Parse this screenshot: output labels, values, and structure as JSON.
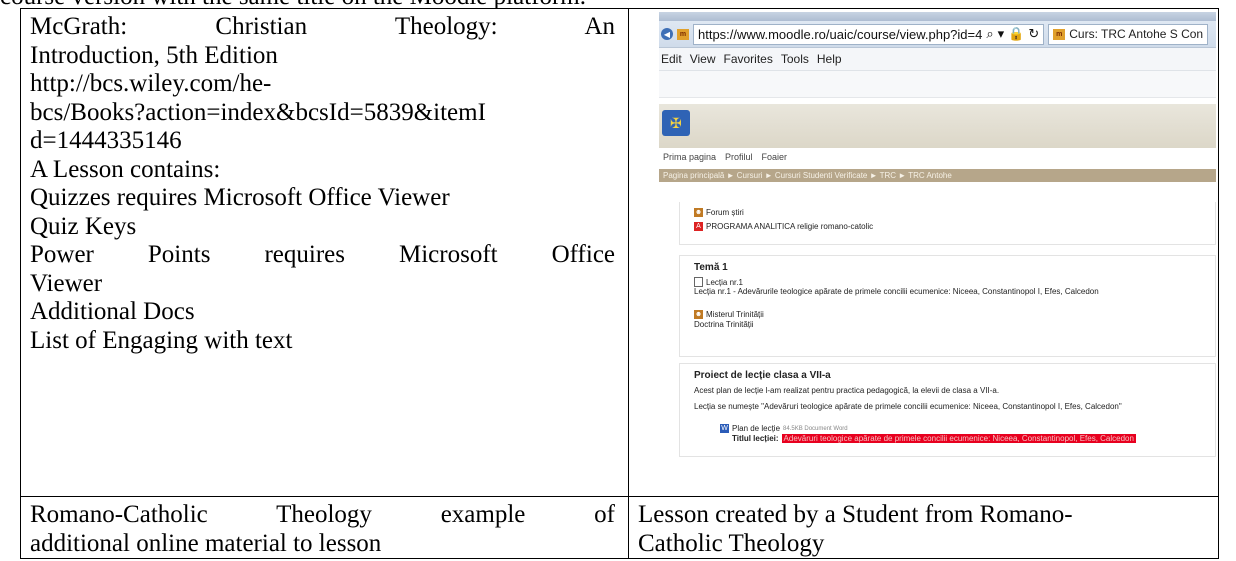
{
  "document": {
    "top_line": "course version with the same title on the Moodle platform.",
    "left_cell": {
      "citation_line1": [
        "McGrath:",
        "Christian",
        "Theology:",
        "An"
      ],
      "citation_line2": "Introduction, 5th Edition",
      "url_lines": [
        "http://bcs.wiley.com/he-",
        "bcs/Books?action=index&bcsId=5839&itemI",
        "d=1444335146"
      ],
      "heading": "A Lesson contains:",
      "items": [
        "Quizzes requires Microsoft Office Viewer",
        "Quiz Keys"
      ],
      "power_points_line1": [
        "Power",
        "Points",
        "requires",
        "Microsoft",
        "Office"
      ],
      "power_points_line2": "Viewer",
      "items_after": [
        "Additional Docs",
        "List of Engaging with text"
      ]
    },
    "captions": {
      "left_line1": [
        "Romano-Catholic",
        "Theology",
        "example",
        "of"
      ],
      "left_line2": "additional online material to lesson",
      "right_line1": "Lesson created by a Student from Romano-",
      "right_line2": "Catholic Theology"
    }
  },
  "screenshot": {
    "browser": {
      "url": "https://www.moodle.ro/uaic/course/view.php?id=4",
      "tab_title": "Curs: TRC Antohe S Con",
      "menu": [
        "Edit",
        "View",
        "Favorites",
        "Tools",
        "Help"
      ]
    },
    "moodle": {
      "nav_links": [
        "Prima pagina",
        "Profilul",
        "Foaier"
      ],
      "breadcrumb": "Pagina principală ► Cursuri ► Cursuri Studenti Verificate ► TRC ► TRC Antohe",
      "top_section": {
        "forum": "Forum știri",
        "program": "PROGRAMA ANALITICA religie romano-catolic"
      },
      "tema": {
        "title": "Temă 1",
        "lesson_link": "Lecția nr.1",
        "lesson_desc": "Lecția nr.1 - Adevărurile teologice apărate de primele concilii ecumenice: Niceea, Constantinopol I, Efes, Calcedon",
        "forum": "Misterul Trinității",
        "doctrine": "Doctrina Trinității"
      },
      "project": {
        "title": "Proiect de lecție clasa a VII-a",
        "desc1": "Acest plan de lecție l-am realizat pentru practica pedagogică, la elevii de clasa a VII-a.",
        "desc2": "Lecția se numește \"Adevăruri teologice apărate de primele concilii ecumenice: Niceea, Constantinopol I, Efes, Calcedon\"",
        "file": "Plan de lecție",
        "file_meta": "84.5KB Document Word",
        "title_label": "Titlul lecției:",
        "title_value": "Adevăruri teologice apărate de primele concilii ecumenice: Niceea, Constantinopol, Efes, Calcedon"
      }
    }
  },
  "colors": {
    "breadcrumb": "#b6a68a",
    "highlight": "#e8001f",
    "logo": "#2f63b5"
  }
}
